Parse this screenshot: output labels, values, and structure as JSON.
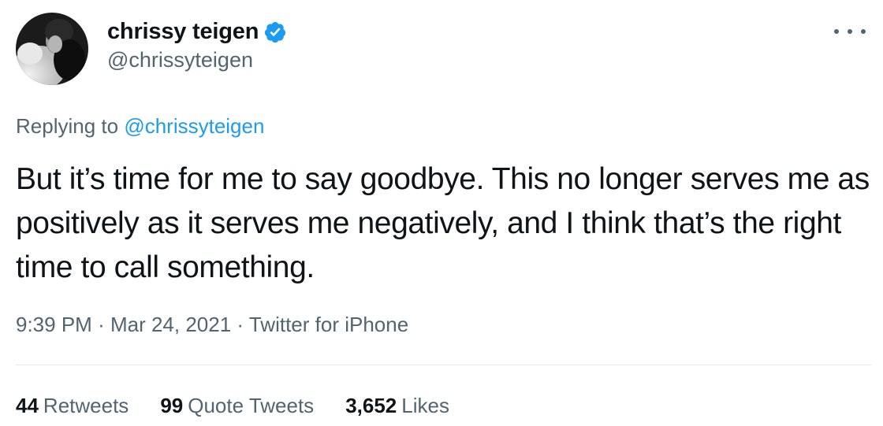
{
  "author": {
    "display_name": "chrissy teigen",
    "handle": "@chrissyteigen",
    "verified": true
  },
  "reply": {
    "prefix": "Replying to",
    "mention": "@chrissyteigen"
  },
  "tweet": {
    "text": "But it’s time for me to say goodbye. This no longer serves me as positively as it serves me negatively, and I think that’s the right time to call something."
  },
  "meta": {
    "time": "9:39 PM",
    "separator": "·",
    "date": "Mar 24, 2021",
    "source": "Twitter for iPhone"
  },
  "stats": {
    "retweets_count": "44",
    "retweets_label": "Retweets",
    "quote_count": "99",
    "quote_label": "Quote Tweets",
    "likes_count": "3,652",
    "likes_label": "Likes"
  },
  "colors": {
    "text": "#0f1419",
    "secondary": "#536471",
    "accent": "#1d9bf0"
  },
  "icons": {
    "verified": "verified-badge-icon",
    "more": "more-options-icon"
  }
}
